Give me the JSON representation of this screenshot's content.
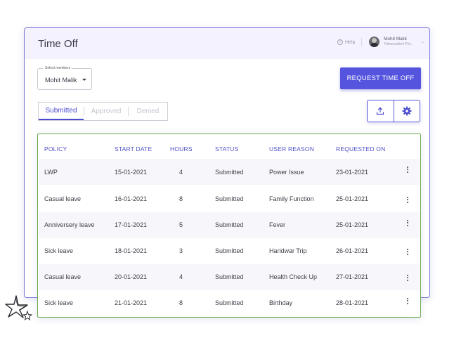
{
  "header": {
    "title": "Time Off",
    "help_label": "Help",
    "help_icon": "question-circle-icon",
    "user": {
      "name": "Mohit Malik",
      "company": "Yahoooodimi Pvt..."
    }
  },
  "member_select": {
    "label": "Select members",
    "value": "Mohit Malik"
  },
  "request_button": "REQUEST TIME OFF",
  "tabs": [
    {
      "label": "Submitted",
      "active": true
    },
    {
      "label": "Approved",
      "active": false
    },
    {
      "label": "Denied",
      "active": false
    }
  ],
  "tools": [
    {
      "icon": "upload-icon"
    },
    {
      "icon": "gear-icon"
    }
  ],
  "table": {
    "headers": [
      "POLICY",
      "START DATE",
      "HOURS",
      "STATUS",
      "USER REASON",
      "REQUESTED ON"
    ],
    "rows": [
      {
        "policy": "LWP",
        "start_date": "15-01-2021",
        "hours": "4",
        "status": "Submitted",
        "reason": "Power Issue",
        "requested_on": "23-01-2021"
      },
      {
        "policy": "Casual leave",
        "start_date": "16-01-2021",
        "hours": "8",
        "status": "Submitted",
        "reason": "Family Function",
        "requested_on": "25-01-2021"
      },
      {
        "policy": "Anniversery leave",
        "start_date": "17-01-2021",
        "hours": "5",
        "status": "Submitted",
        "reason": "Fever",
        "requested_on": "25-01-2021"
      },
      {
        "policy": "Sick leave",
        "start_date": "18-01-2021",
        "hours": "3",
        "status": "Submitted",
        "reason": "Haridwar Trip",
        "requested_on": "26-01-2021"
      },
      {
        "policy": "Casual leave",
        "start_date": "20-01-2021",
        "hours": "4",
        "status": "Submitted",
        "reason": "Health Check Up",
        "requested_on": "27-01-2021"
      },
      {
        "policy": "Sick leave",
        "start_date": "21-01-2021",
        "hours": "8",
        "status": "Submitted",
        "reason": "Birthday",
        "requested_on": "28-01-2021"
      }
    ]
  },
  "colors": {
    "accent": "#5454df",
    "header_bg": "#f3f2fe",
    "table_border": "#6aaa4c",
    "link": "#4b4bcf"
  },
  "decorations": {
    "doodle": "star-doodle-icon"
  }
}
